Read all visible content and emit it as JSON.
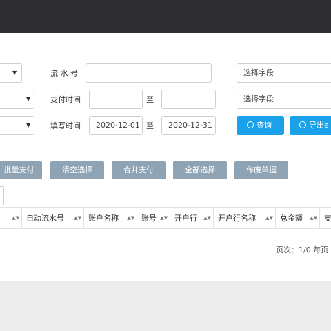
{
  "filters": {
    "serial_label": "流 水 号",
    "serial_value": "",
    "pay_time_label": "支付时间",
    "pay_time_start": "",
    "pay_time_to": "至",
    "pay_time_end": "",
    "fill_time_label": "填写时间",
    "fill_time_start": "2020-12-01",
    "fill_time_to": "至",
    "fill_time_end": "2020-12-31",
    "field_select_1": "选择字段",
    "field_select_2": "选择字段"
  },
  "buttons": {
    "query": "查询",
    "export": "导出e"
  },
  "actions": [
    "批量支付",
    "清空选择",
    "合并支付",
    "全部选择",
    "作废单据"
  ],
  "table": {
    "columns": [
      "自动流水号",
      "账户名称",
      "账号",
      "开户行",
      "开户行名称",
      "总金额",
      "支"
    ]
  },
  "pager": {
    "text": "页次：1/0  每页"
  },
  "icons": {
    "caret": "caret-down-icon",
    "sort": "sort-icon",
    "search": "search-icon"
  },
  "colors": {
    "primary": "#1aa1ea",
    "action": "#8ea3b4",
    "topbar": "#2e2e30"
  }
}
